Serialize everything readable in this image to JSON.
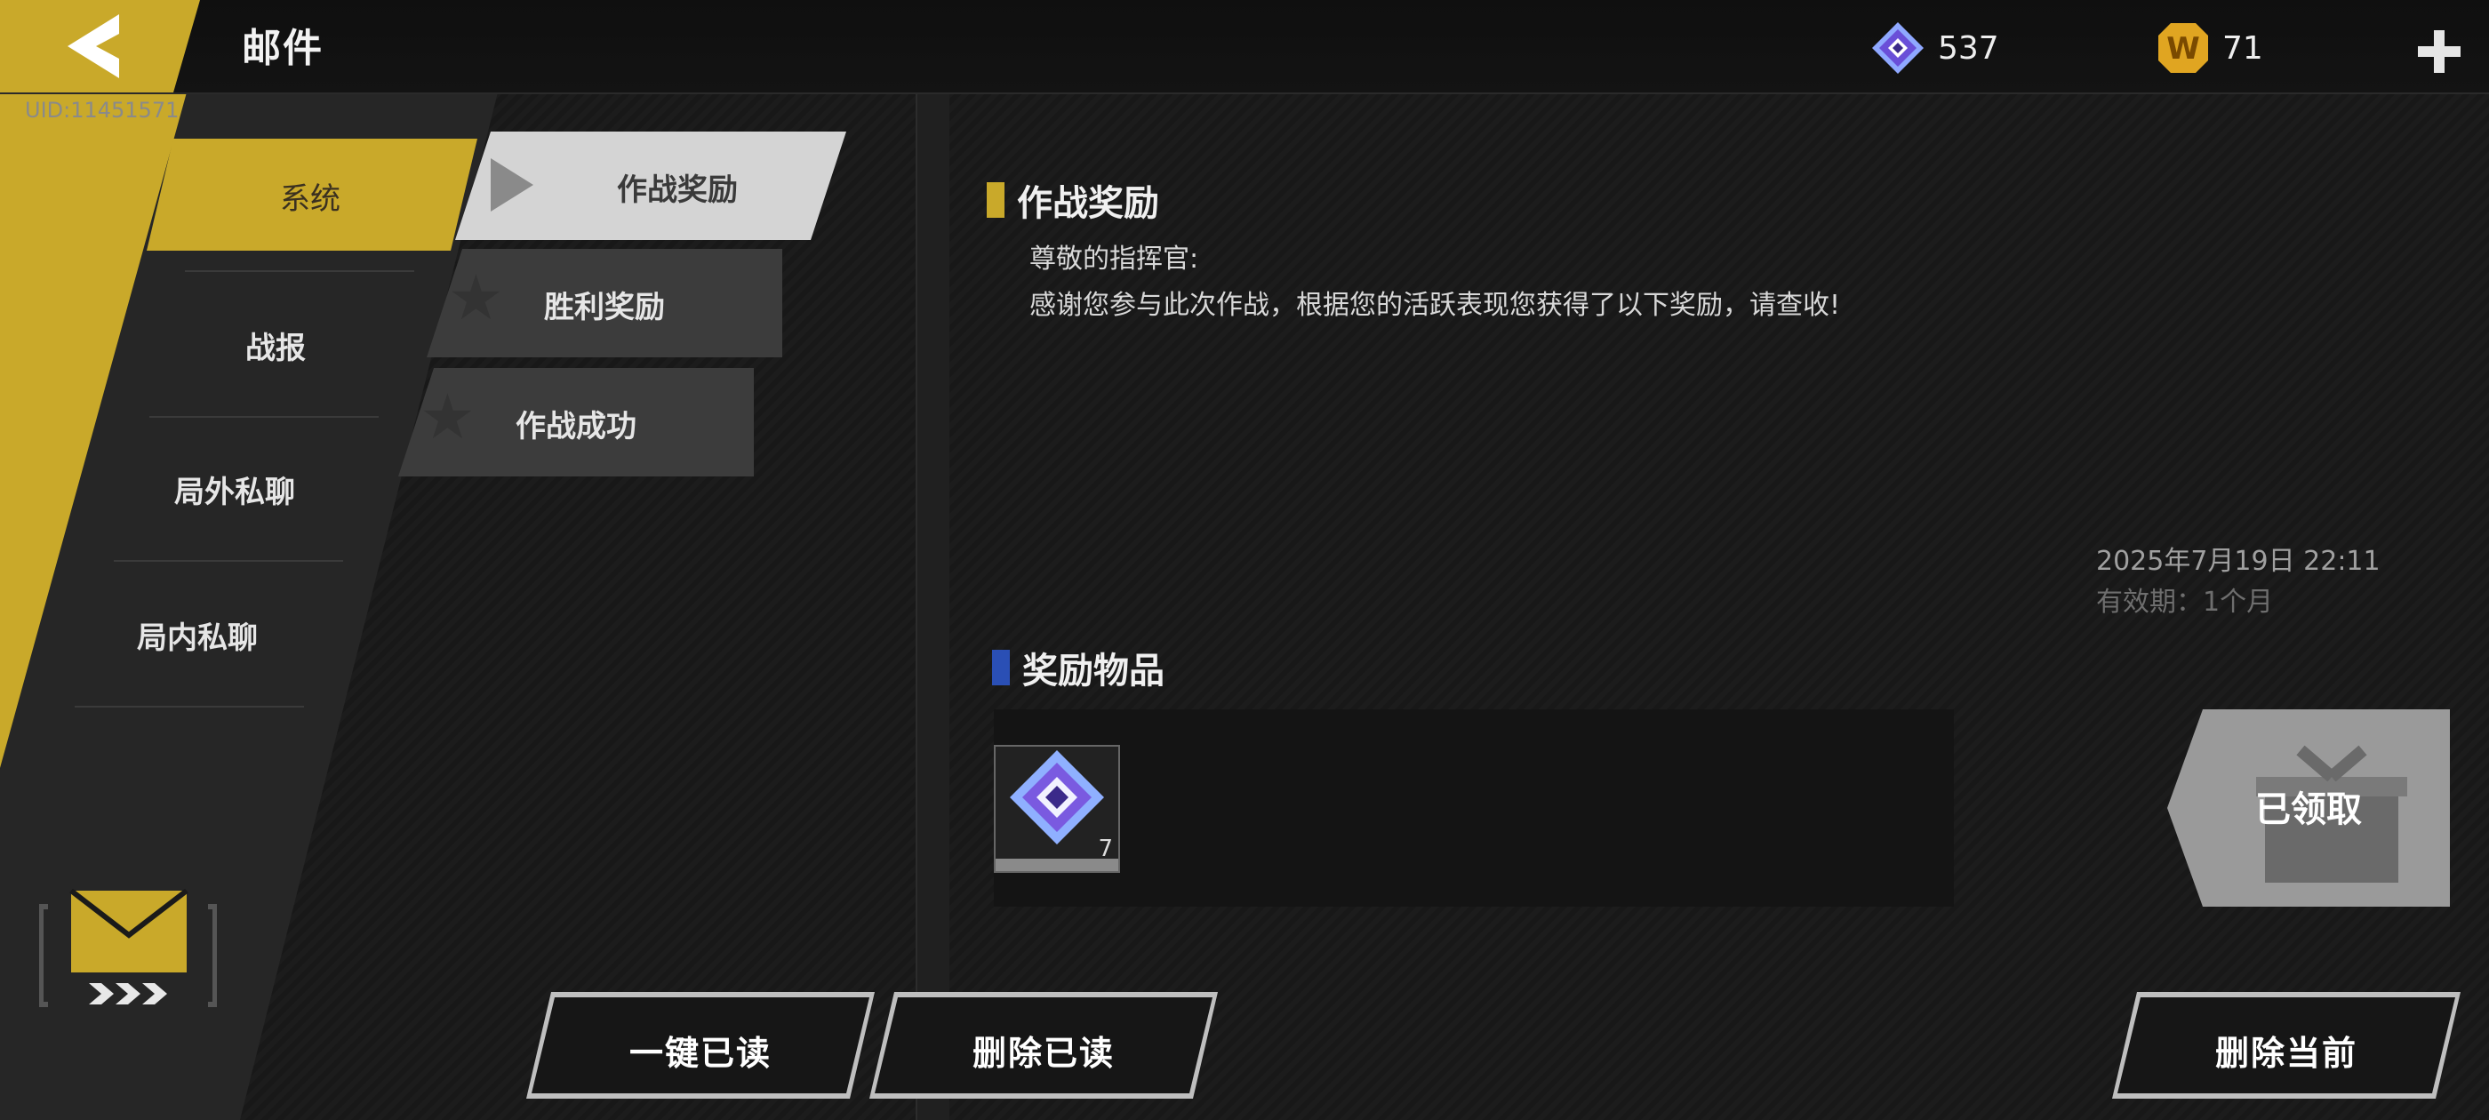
{
  "header": {
    "title": "邮件",
    "uid": "UID:11451571",
    "currency": [
      {
        "icon": "gem-icon",
        "value": "537"
      },
      {
        "icon": "w-coin-icon",
        "value": "71"
      }
    ]
  },
  "sidebar": {
    "items": [
      {
        "label": "系统",
        "active": true
      },
      {
        "label": "战报"
      },
      {
        "label": "局外私聊"
      },
      {
        "label": "局内私聊"
      }
    ]
  },
  "mail_list": [
    {
      "label": "作战奖励",
      "selected": true
    },
    {
      "label": "胜利奖励"
    },
    {
      "label": "作战成功"
    }
  ],
  "mail": {
    "title": "作战奖励",
    "greeting": "尊敬的指挥官:",
    "body": "感谢您参与此次作战，根据您的活跃表现您获得了以下奖励，请查收!",
    "date": "2025年7月19日  22:11",
    "validity": "有效期：1个月",
    "rewards_heading": "奖励物品",
    "rewards": [
      {
        "icon": "gem-icon",
        "count": "7"
      }
    ],
    "claim_status": "已领取"
  },
  "buttons": {
    "read_all": "一键已读",
    "delete_read": "删除已读",
    "delete_current": "删除当前"
  },
  "colors": {
    "accent": "#c9a92a",
    "blue_bar": "#2a4fb5",
    "gold_bar": "#c9a92a"
  }
}
